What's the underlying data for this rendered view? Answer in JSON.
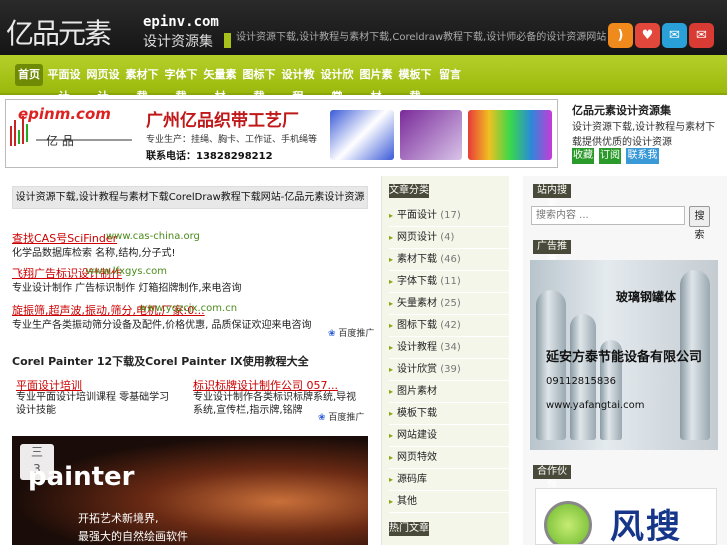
{
  "header": {
    "logo_cn": "亿品元素",
    "logo_url": "epinv.com",
    "logo_sub": "设计资源集",
    "slogan": "设计资源下载,设计教程与素材下载,Coreldraw教程下载,设计师必备的设计资源网站",
    "icons": [
      "rss-icon",
      "favorite-icon",
      "talk-icon",
      "mail-icon"
    ]
  },
  "nav": {
    "items": [
      "首页",
      "平面设计",
      "网页设计",
      "素材下载",
      "字体下载",
      "矢量素材",
      "图标下载",
      "设计教程",
      "设计欣赏",
      "图片素材",
      "模板下载",
      "留言"
    ]
  },
  "banner": {
    "url": "epinm.com",
    "brand": "亿 品",
    "title": "广州亿品织带工艺厂",
    "line2": "专业生产：挂绳、胸卡、工作证、手机绳等",
    "line3": "联系电话：13828298212"
  },
  "promo": {
    "title": "亿品元素设计资源集",
    "text": "设计资源下载,设计教程与素材下载提供优质的设计资源",
    "buttons": [
      "收藏",
      "订阅",
      "联系我们"
    ]
  },
  "main": {
    "title": "设计资源下载,设计教程与素材下载CorelDraw教程下载网站-亿品元素设计资源",
    "ads": [
      {
        "link": "查找CAS号SciFinder",
        "domain": "www.cas-china.org",
        "desc": "化学品数据库检索 名称,结构,分子式!"
      },
      {
        "link": "飞翔广告标识设计制作",
        "domain": "www.lfxgys.com",
        "desc": "专业设计制作 广告标识制作 灯箱招牌制作,来电咨询"
      },
      {
        "link": "旋振筛,超声波,振动,筛分,电机,厂家:0...",
        "domain": "www.yqzcjx.com.cn",
        "desc": "专业生产各类振动筛分设备及配件,价格优惠, 品质保证欢迎来电咨询"
      }
    ],
    "baidu_label": "百度推广",
    "section_title": "Corel Painter 12下载及Corel Painter IX使用教程大全",
    "ads2": [
      {
        "link": "平面设计培训",
        "desc": "专业平面设计培训课程 零基础学习设计技能"
      },
      {
        "link": "标识标牌设计制作公司 057...",
        "desc": "专业设计制作各类标识标牌系统,导视系统,宣传栏,指示牌,铭牌"
      }
    ],
    "feature": {
      "logo": "painter",
      "tag1": "开拓艺术新境界,",
      "tag2": "最强大的自然绘画软件",
      "date_top": "三",
      "date_num": "3"
    }
  },
  "categories": {
    "header": "文章分类",
    "items": [
      {
        "name": "平面设计",
        "count": "(17)"
      },
      {
        "name": "网页设计",
        "count": "(4)"
      },
      {
        "name": "素材下载",
        "count": "(46)"
      },
      {
        "name": "字体下载",
        "count": "(11)"
      },
      {
        "name": "矢量素材",
        "count": "(25)"
      },
      {
        "name": "图标下载",
        "count": "(42)"
      },
      {
        "name": "设计教程",
        "count": "(34)"
      },
      {
        "name": "设计欣赏",
        "count": "(39)"
      },
      {
        "name": "图片素材",
        "count": ""
      },
      {
        "name": "模板下载",
        "count": ""
      },
      {
        "name": "网站建设",
        "count": ""
      },
      {
        "name": "网页特效",
        "count": ""
      },
      {
        "name": "源码库",
        "count": ""
      },
      {
        "name": "其他",
        "count": ""
      }
    ],
    "header2": "热门文章"
  },
  "sidebar": {
    "search_header": "站内搜索",
    "search_placeholder": "搜索内容 ...",
    "search_button": "搜索",
    "ad_header": "广告推荐",
    "tank_t1": "玻璃钢罐体",
    "tank_t2": "延安方泰节能设备有限公司",
    "tank_t3": "09112815836",
    "tank_t4": "www.yafangtai.com",
    "partner_header": "合作伙伴",
    "partner_text": "风搜"
  },
  "colors": {
    "nav_green": "#9ab80c",
    "header_dark": "#1a1a1a",
    "ad_red": "#c00000",
    "domain_green": "#4a8a1a",
    "promo_green": "#2a9a2a",
    "promo_blue": "#3a9ad8"
  }
}
